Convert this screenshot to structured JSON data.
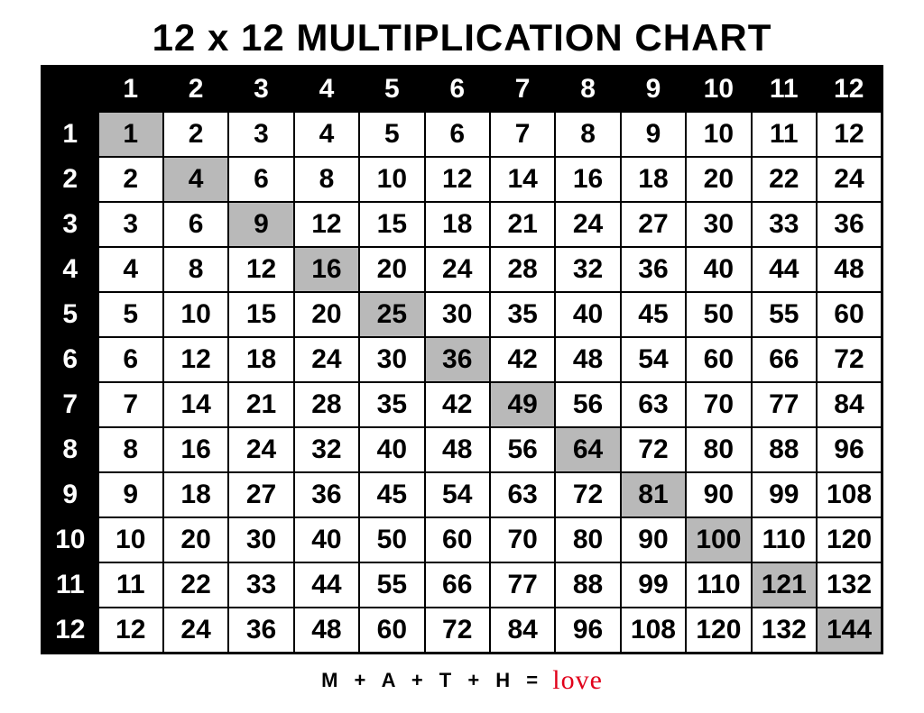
{
  "title": "12 x 12 MULTIPLICATION CHART",
  "size": 12,
  "col_headers": [
    "1",
    "2",
    "3",
    "4",
    "5",
    "6",
    "7",
    "8",
    "9",
    "10",
    "11",
    "12"
  ],
  "row_headers": [
    "1",
    "2",
    "3",
    "4",
    "5",
    "6",
    "7",
    "8",
    "9",
    "10",
    "11",
    "12"
  ],
  "chart_data": {
    "type": "table",
    "title": "12 x 12 Multiplication Chart",
    "rows": [
      [
        1,
        2,
        3,
        4,
        5,
        6,
        7,
        8,
        9,
        10,
        11,
        12
      ],
      [
        2,
        4,
        6,
        8,
        10,
        12,
        14,
        16,
        18,
        20,
        22,
        24
      ],
      [
        3,
        6,
        9,
        12,
        15,
        18,
        21,
        24,
        27,
        30,
        33,
        36
      ],
      [
        4,
        8,
        12,
        16,
        20,
        24,
        28,
        32,
        36,
        40,
        44,
        48
      ],
      [
        5,
        10,
        15,
        20,
        25,
        30,
        35,
        40,
        45,
        50,
        55,
        60
      ],
      [
        6,
        12,
        18,
        24,
        30,
        36,
        42,
        48,
        54,
        60,
        66,
        72
      ],
      [
        7,
        14,
        21,
        28,
        35,
        42,
        49,
        56,
        63,
        70,
        77,
        84
      ],
      [
        8,
        16,
        24,
        32,
        40,
        48,
        56,
        64,
        72,
        80,
        88,
        96
      ],
      [
        9,
        18,
        27,
        36,
        45,
        54,
        63,
        72,
        81,
        90,
        99,
        108
      ],
      [
        10,
        20,
        30,
        40,
        50,
        60,
        70,
        80,
        90,
        100,
        110,
        120
      ],
      [
        11,
        22,
        33,
        44,
        55,
        66,
        77,
        88,
        99,
        110,
        121,
        132
      ],
      [
        12,
        24,
        36,
        48,
        60,
        72,
        84,
        96,
        108,
        120,
        132,
        144
      ]
    ]
  },
  "footer": {
    "prefix": "M + A + T + H = ",
    "love": "love"
  }
}
